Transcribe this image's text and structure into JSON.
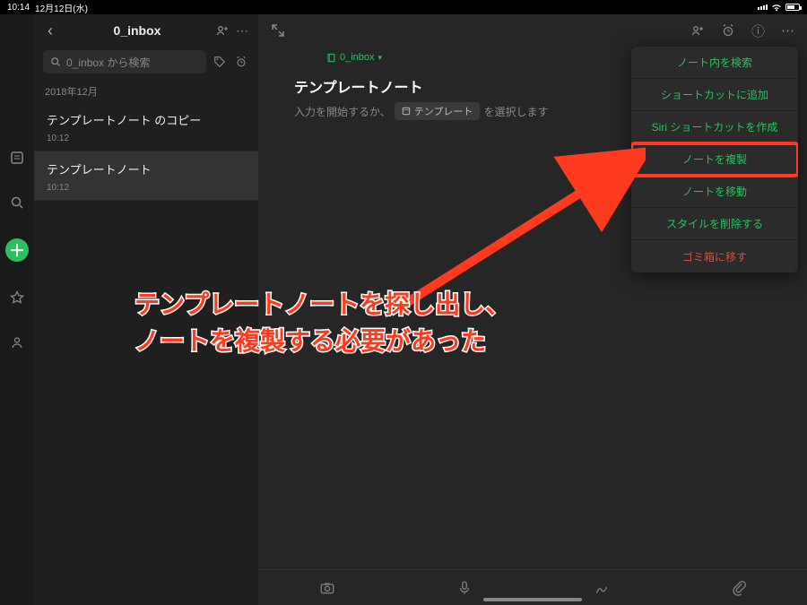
{
  "status": {
    "time": "10:14",
    "date": "12月12日(水)"
  },
  "list": {
    "title": "0_inbox",
    "search_placeholder": "0_inbox から検索",
    "section": "2018年12月",
    "items": [
      {
        "title": "テンプレートノート のコピー",
        "time": "10:12",
        "selected": false
      },
      {
        "title": "テンプレートノート",
        "time": "10:12",
        "selected": true
      }
    ]
  },
  "editor": {
    "breadcrumb_icon": "notebook-icon",
    "breadcrumb": "0_inbox",
    "note_title": "テンプレートノート",
    "hint_prefix": "入力を開始するか、",
    "template_chip": "テンプレート",
    "hint_suffix": "を選択します"
  },
  "context_menu": [
    {
      "label": "ノート内を検索",
      "danger": false,
      "highlight": false
    },
    {
      "label": "ショートカットに追加",
      "danger": false,
      "highlight": false
    },
    {
      "label": "Siri ショートカットを作成",
      "danger": false,
      "highlight": false
    },
    {
      "label": "ノートを複製",
      "danger": false,
      "highlight": true
    },
    {
      "label": "ノートを移動",
      "danger": false,
      "highlight": false
    },
    {
      "label": "スタイルを削除する",
      "danger": false,
      "highlight": false
    },
    {
      "label": "ゴミ箱に移す",
      "danger": true,
      "highlight": false
    }
  ],
  "annotation": {
    "line1": "テンプレートノートを探し出し、",
    "line2": "ノートを複製する必要があった"
  },
  "icons": {
    "back": "‹",
    "add_person": "person-plus-icon",
    "more": "⋯",
    "expand": "expand-icon",
    "reminder": "alarm-icon",
    "info": "ⓘ",
    "tag": "tag-icon",
    "camera": "camera-icon",
    "mic": "mic-icon",
    "draw": "pen-icon",
    "attach": "paperclip-icon"
  }
}
